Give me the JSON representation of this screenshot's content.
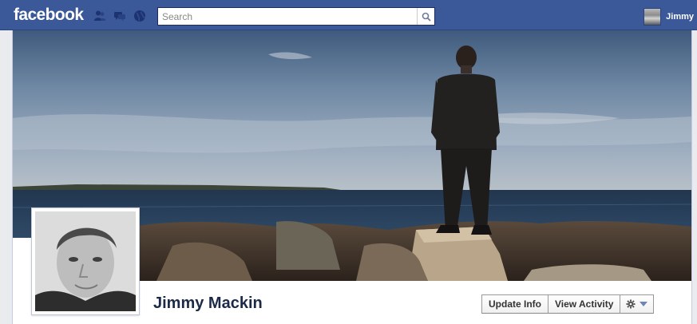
{
  "topbar": {
    "logo": "facebook",
    "search_placeholder": "Search",
    "user_name": "Jimmy",
    "icons": [
      "friend-requests-icon",
      "messages-icon",
      "notifications-icon"
    ]
  },
  "profile": {
    "name": "Jimmy Mackin"
  },
  "actions": {
    "update_info": "Update Info",
    "view_activity": "View Activity",
    "settings_icon": "gear-icon"
  },
  "colors": {
    "brand_blue": "#3b5998",
    "name_color": "#1c2a47"
  }
}
